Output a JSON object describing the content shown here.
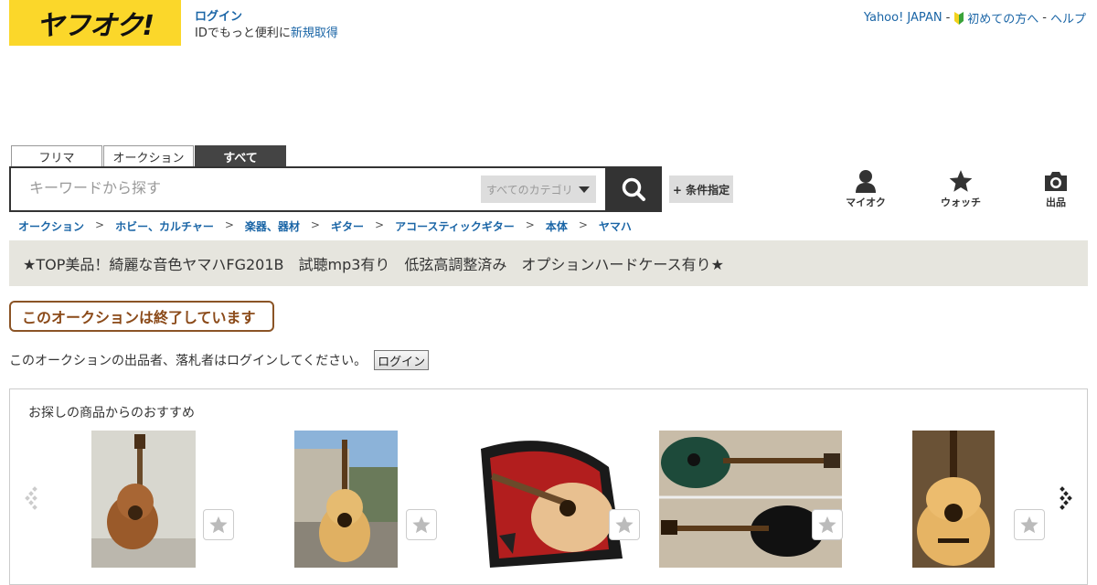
{
  "header": {
    "logo": "ヤフオク!",
    "login_link": "ログイン",
    "login_note": "IDでもっと便利に",
    "signup_link": "新規取得",
    "top_links": [
      "Yahoo! JAPAN",
      "初めての方へ",
      "ヘルプ"
    ],
    "top_sep": "-"
  },
  "search": {
    "tabs": [
      "フリマ",
      "オークション",
      "すべて"
    ],
    "active_tab": "すべて",
    "placeholder": "キーワードから探す",
    "category": "すべてのカテゴリ",
    "condition_button": "+ 条件指定"
  },
  "user_menu": [
    {
      "label": "マイオク",
      "icon": "person-icon"
    },
    {
      "label": "ウォッチ",
      "icon": "star-icon"
    },
    {
      "label": "出品",
      "icon": "camera-icon"
    }
  ],
  "breadcrumb": [
    "オークション",
    "ホビー、カルチャー",
    "楽器、器材",
    "ギター",
    "アコースティックギター",
    "本体",
    "ヤマハ"
  ],
  "breadcrumb_sep": ">",
  "item": {
    "title": "★TOP美品！綺麗な音色ヤマハFG201B　試聴mp3有り　低弦高調整済み　オプションハードケース有り★",
    "status": "このオークションは終了しています",
    "login_note": "このオークションの出品者、落札者はログインしてください。",
    "login_button": "ログイン"
  },
  "recommend": {
    "title": "お探しの商品からのおすすめ",
    "count": 5
  },
  "colors": {
    "brand_yellow": "#fbd72a",
    "link_blue": "#1a65a6",
    "title_bg": "#e6e5de",
    "ended_border": "#8b5426"
  }
}
